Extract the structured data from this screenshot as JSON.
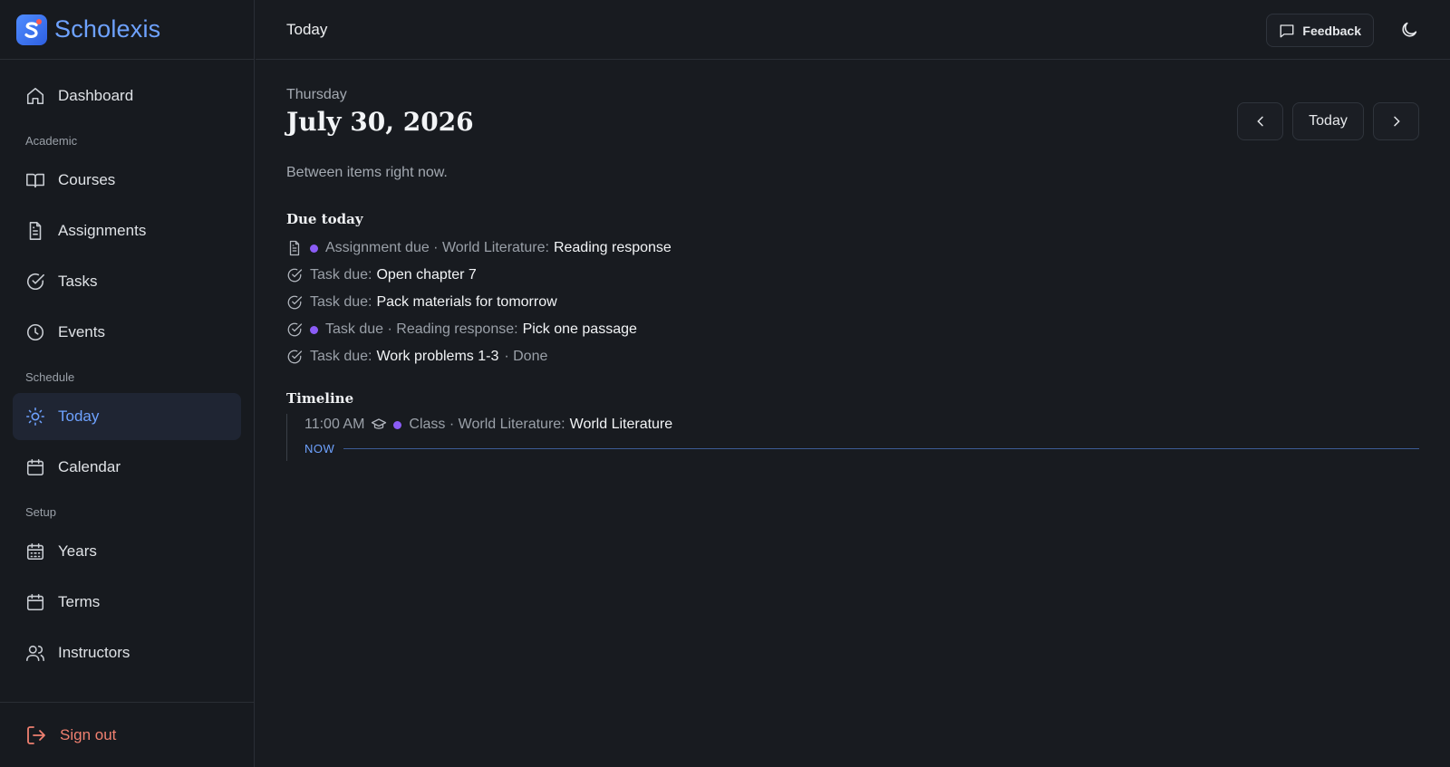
{
  "brand": {
    "name": "Scholexis",
    "accent": "#6ea2ff"
  },
  "sidebar": {
    "dashboard": {
      "label": "Dashboard",
      "icon": "home-icon"
    },
    "sections": {
      "academic": "Academic",
      "schedule": "Schedule",
      "setup": "Setup"
    },
    "academic_items": [
      {
        "label": "Courses",
        "icon": "book-icon"
      },
      {
        "label": "Assignments",
        "icon": "document-icon"
      },
      {
        "label": "Tasks",
        "icon": "check-circle-icon"
      },
      {
        "label": "Events",
        "icon": "clock-icon"
      }
    ],
    "schedule_items": [
      {
        "label": "Today",
        "icon": "sun-icon",
        "active": true
      },
      {
        "label": "Calendar",
        "icon": "calendar-icon"
      }
    ],
    "setup_items": [
      {
        "label": "Years",
        "icon": "calendar-grid-icon"
      },
      {
        "label": "Terms",
        "icon": "calendar-icon"
      },
      {
        "label": "Instructors",
        "icon": "users-icon"
      }
    ],
    "sign_out": {
      "label": "Sign out",
      "icon": "logout-icon",
      "color": "#f08070"
    }
  },
  "topbar": {
    "title": "Today",
    "feedback_label": "Feedback",
    "theme_icon": "moon-icon"
  },
  "main": {
    "weekday": "Thursday",
    "date": "July 30, 2026",
    "nav": {
      "today_label": "Today",
      "prev_icon": "chevron-left-icon",
      "next_icon": "chevron-right-icon"
    },
    "status": "Between items right now.",
    "due_heading": "Due today",
    "due_items": [
      {
        "icon": "document-icon",
        "dot": true,
        "prefix": "Assignment due · World Literature:",
        "title": "Reading response",
        "suffix": ""
      },
      {
        "icon": "check-circle-icon",
        "dot": false,
        "prefix": "Task due:",
        "title": "Open chapter 7",
        "suffix": ""
      },
      {
        "icon": "check-circle-icon",
        "dot": false,
        "prefix": "Task due:",
        "title": "Pack materials for tomorrow",
        "suffix": ""
      },
      {
        "icon": "check-circle-icon",
        "dot": true,
        "prefix": "Task due · Reading response:",
        "title": "Pick one passage",
        "suffix": ""
      },
      {
        "icon": "check-circle-icon",
        "dot": false,
        "prefix": "Task due:",
        "title": "Work problems 1-3",
        "suffix": "· Done"
      }
    ],
    "timeline_heading": "Timeline",
    "timeline_items": [
      {
        "time": "11:00 AM",
        "icon": "graduation-cap-icon",
        "prefix": "Class · World Literature:",
        "title": "World Literature"
      }
    ],
    "now_label": "NOW",
    "dot_color": "#8b5cf6"
  }
}
